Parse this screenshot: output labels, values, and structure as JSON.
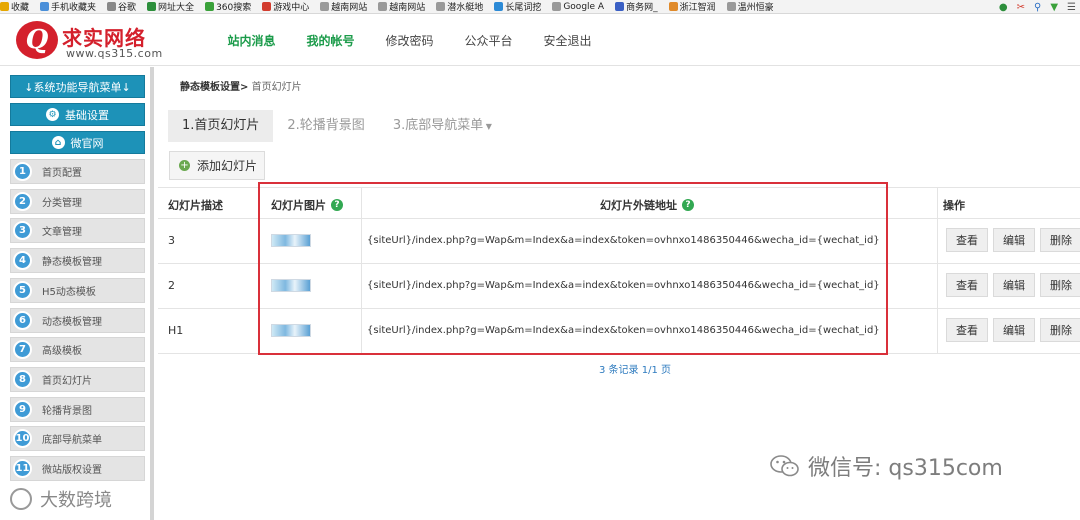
{
  "bookmarks": [
    {
      "label": "收藏",
      "color": "#e6a700"
    },
    {
      "label": "手机收藏夹",
      "color": "#4a8fd9"
    },
    {
      "label": "谷歌",
      "color": "#888888"
    },
    {
      "label": "网址大全",
      "color": "#2d8f3c"
    },
    {
      "label": "360搜索",
      "color": "#3aa13a"
    },
    {
      "label": "游戏中心",
      "color": "#d23c2e"
    },
    {
      "label": "越南网站",
      "color": "#999999"
    },
    {
      "label": "越南网站",
      "color": "#999999"
    },
    {
      "label": "潜水艇地",
      "color": "#999999"
    },
    {
      "label": "长尾词挖",
      "color": "#2c8ad6"
    },
    {
      "label": "Google A",
      "color": "#999999"
    },
    {
      "label": "商务网_",
      "color": "#3a5fc4"
    },
    {
      "label": "浙江智润",
      "color": "#e08a2a"
    },
    {
      "label": "温州恒豪",
      "color": "#999999"
    }
  ],
  "header": {
    "logo_mark": "Q",
    "brand": "求实网络",
    "url": "www.qs315.com",
    "nav": [
      "站内消息",
      "我的帐号",
      "修改密码",
      "公众平台",
      "安全退出"
    ],
    "active_nav": 0,
    "accent": "#1b9b4a"
  },
  "sidebar": {
    "nav_menu": "↓系统功能导航菜单↓",
    "basic_settings": "基础设置",
    "micro_site": "微官网",
    "items": [
      {
        "num": "1",
        "label": "首页配置"
      },
      {
        "num": "2",
        "label": "分类管理"
      },
      {
        "num": "3",
        "label": "文章管理"
      },
      {
        "num": "4",
        "label": "静态模板管理"
      },
      {
        "num": "5",
        "label": "H5动态模板"
      },
      {
        "num": "6",
        "label": "动态模板管理"
      },
      {
        "num": "7",
        "label": "高级模板"
      },
      {
        "num": "8",
        "label": "首页幻灯片"
      },
      {
        "num": "9",
        "label": "轮播背景图"
      },
      {
        "num": "10",
        "label": "底部导航菜单"
      },
      {
        "num": "11",
        "label": "微站版权设置"
      }
    ]
  },
  "main": {
    "breadcrumb_parent": "静态模板设置>",
    "breadcrumb_current": "首页幻灯片",
    "tabs": [
      "1.首页幻灯片",
      "2.轮播背景图",
      "3.底部导航菜单"
    ],
    "add_button": "添加幻灯片",
    "columns": [
      "幻灯片描述",
      "幻灯片图片",
      "幻灯片外链地址",
      "操作"
    ],
    "rows": [
      {
        "desc": "3",
        "url": "{siteUrl}/index.php?g=Wap&m=Index&a=index&token=ovhnxo1486350446&wecha_id={wechat_id}"
      },
      {
        "desc": "2",
        "url": "{siteUrl}/index.php?g=Wap&m=Index&a=index&token=ovhnxo1486350446&wecha_id={wechat_id}"
      },
      {
        "desc": "H1",
        "url": "{siteUrl}/index.php?g=Wap&m=Index&a=index&token=ovhnxo1486350446&wecha_id={wechat_id}"
      }
    ],
    "actions": [
      "查看",
      "编辑",
      "删除"
    ],
    "pager": "3 条记录 1/1 页"
  },
  "watermark": {
    "wechat": "微信号: qs315com",
    "bottom_left": "大数跨境"
  }
}
